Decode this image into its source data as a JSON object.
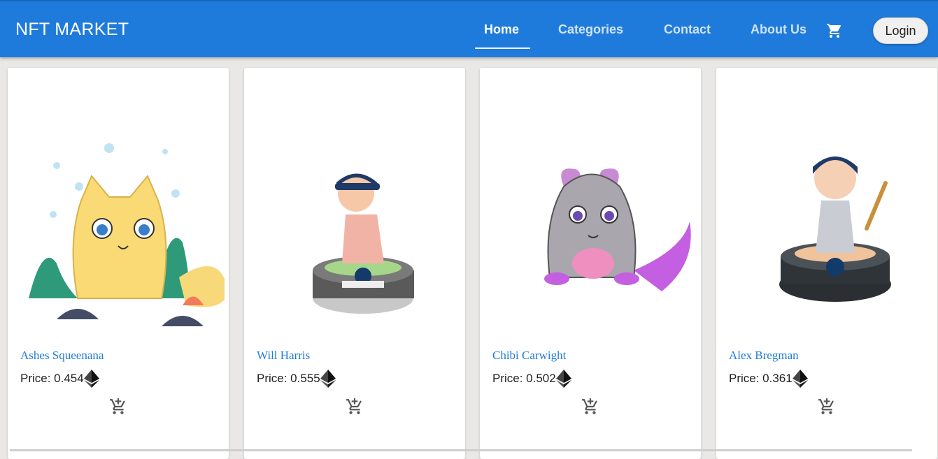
{
  "header": {
    "brand": "NFT MARKET",
    "nav": [
      "Home",
      "Categories",
      "Contact",
      "About Us"
    ],
    "active": "Home",
    "login": "Login"
  },
  "cards": [
    {
      "name": "Ashes Squeenana",
      "price": "Price: 0.454"
    },
    {
      "name": "Will Harris",
      "price": "Price: 0.555"
    },
    {
      "name": "Chibi Carwight",
      "price": "Price: 0.502"
    },
    {
      "name": "Alex Bregman",
      "price": "Price: 0.361"
    }
  ],
  "colors": {
    "appbar": "#1f7bdb",
    "link": "#1f7bdb",
    "background": "#e9e8e6"
  },
  "icons": [
    "cart-icon",
    "ethereum-icon",
    "add-to-cart-icon"
  ]
}
